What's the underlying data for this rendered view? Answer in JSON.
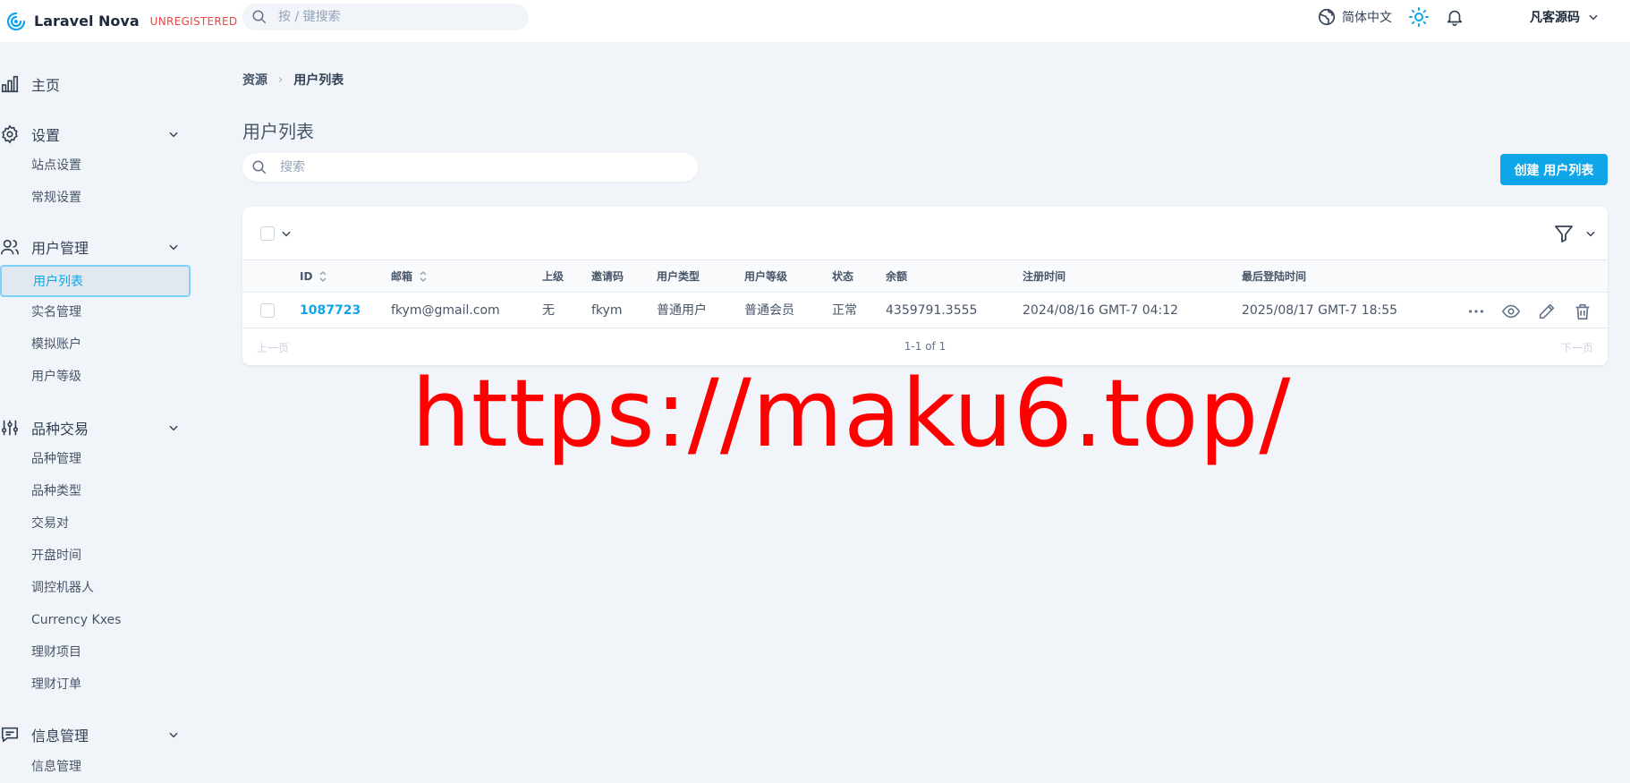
{
  "header": {
    "app_name": "Laravel Nova",
    "badge": "UNREGISTERED",
    "search_placeholder": "按 / 键搜索",
    "language": "简体中文",
    "user_name": "凡客源码",
    "brand_color": "#0ea5e9"
  },
  "sidebar": {
    "sections": [
      {
        "label": "主页",
        "icon": "chart-bar-icon"
      },
      {
        "label": "设置",
        "icon": "gear-icon",
        "items": [
          "站点设置",
          "常规设置"
        ]
      },
      {
        "label": "用户管理",
        "icon": "users-icon",
        "items": [
          "用户列表",
          "实名管理",
          "模拟账户",
          "用户等级"
        ],
        "active": "用户列表"
      },
      {
        "label": "品种交易",
        "icon": "adjustments-icon",
        "items": [
          "品种管理",
          "品种类型",
          "交易对",
          "开盘时间",
          "调控机器人",
          "Currency Kxes",
          "理财项目",
          "理财订单"
        ]
      },
      {
        "label": "信息管理",
        "icon": "chat-icon",
        "items": [
          "信息管理"
        ]
      }
    ]
  },
  "breadcrumb": {
    "root": "资源",
    "current": "用户列表"
  },
  "page": {
    "title": "用户列表",
    "search_placeholder": "搜索",
    "create_label": "创建 用户列表"
  },
  "table": {
    "columns": [
      "ID",
      "邮箱",
      "上级",
      "邀请码",
      "用户类型",
      "用户等级",
      "状态",
      "余额",
      "注册时间",
      "最后登陆时间"
    ],
    "rows": [
      {
        "id": "1087723",
        "email": "fkym@gmail.com",
        "parent": "无",
        "invite_code": "fkym",
        "user_type": "普通用户",
        "user_level": "普通会员",
        "status": "正常",
        "balance": "4359791.3555",
        "registered": "2024/08/16 GMT-7 04:12",
        "last_login": "2025/08/17 GMT-7 18:55"
      }
    ]
  },
  "pagination": {
    "prev": "上一页",
    "info": "1-1 of 1",
    "next": "下一页"
  },
  "watermark": "https://maku6.top/"
}
